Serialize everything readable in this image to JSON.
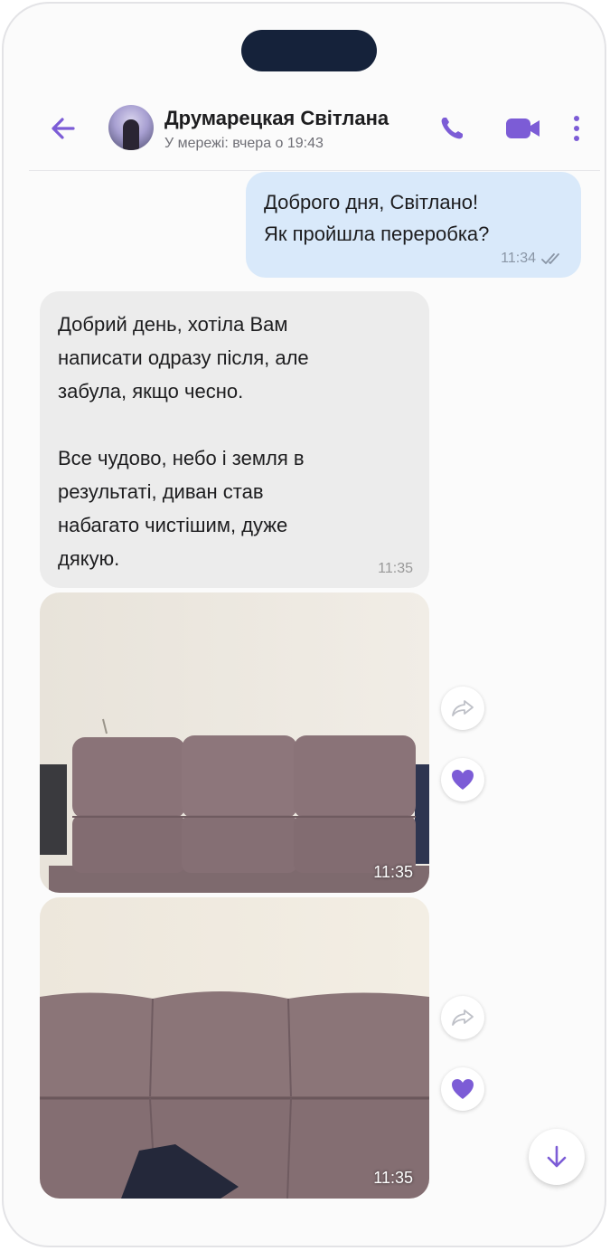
{
  "header": {
    "contact_name": "Друмарецкая Світлана",
    "status": "У мережі: вчера о 19:43"
  },
  "icons": {
    "back": "arrow-left-icon",
    "call": "phone-icon",
    "video": "video-camera-icon",
    "more": "more-vertical-icon",
    "forward": "forward-icon",
    "like": "heart-icon",
    "scroll_down": "arrow-down-icon"
  },
  "colors": {
    "accent": "#7c5cd6",
    "outgoing_bubble": "#d9e9fa",
    "incoming_bubble": "#ececec"
  },
  "messages": [
    {
      "direction": "outgoing",
      "text": "Доброго дня, Світлано!\nЯк пройшла переробка?",
      "time": "11:34",
      "status": "read"
    },
    {
      "direction": "incoming",
      "text": "Добрий день, хотіла Вам\nнаписати одразу після, але\nзабула, якщо чесно.\n\nВсе чудово, небо і земля в\nрезультаті, диван став\nнабагато чистішим, дуже\nдякую.",
      "time": "11:35"
    },
    {
      "direction": "incoming",
      "type": "photo",
      "time": "11:35"
    },
    {
      "direction": "incoming",
      "type": "photo",
      "time": "11:35"
    }
  ]
}
